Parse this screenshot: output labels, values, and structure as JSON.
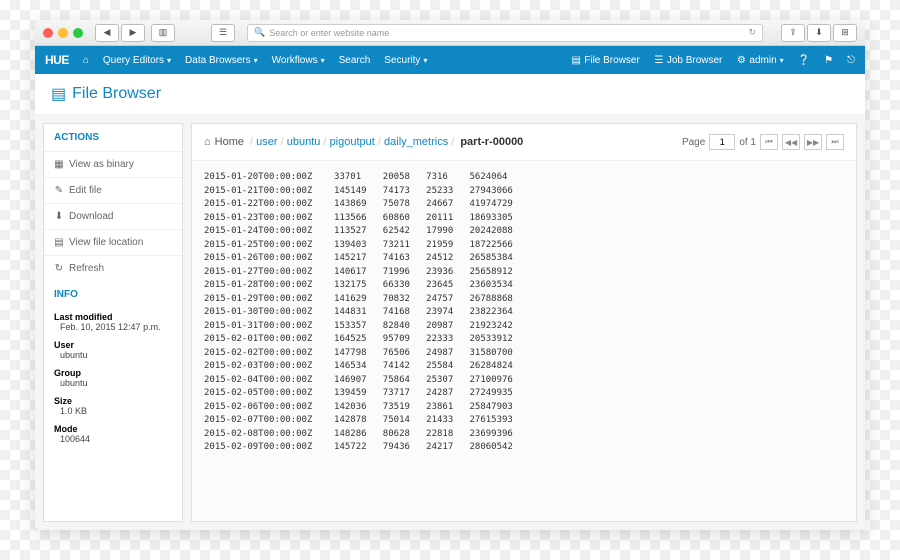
{
  "browser": {
    "placeholder": "Search or enter website name"
  },
  "topnav": {
    "logo": "HUE",
    "home": "⌂",
    "items": [
      "Query Editors",
      "Data Browsers",
      "Workflows",
      "Search",
      "Security"
    ],
    "right": {
      "file_browser": "File Browser",
      "job_browser": "Job Browser",
      "user": "admin"
    }
  },
  "page_title": "File Browser",
  "sidebar": {
    "actions_hdr": "ACTIONS",
    "actions": [
      {
        "icon": "▦",
        "label": "View as binary"
      },
      {
        "icon": "✎",
        "label": "Edit file"
      },
      {
        "icon": "⬇",
        "label": "Download"
      },
      {
        "icon": "▤",
        "label": "View file location"
      },
      {
        "icon": "↻",
        "label": "Refresh"
      }
    ],
    "info_hdr": "INFO",
    "info": {
      "last_modified_lbl": "Last modified",
      "last_modified": "Feb. 10, 2015 12:47 p.m.",
      "user_lbl": "User",
      "user": "ubuntu",
      "group_lbl": "Group",
      "group": "ubuntu",
      "size_lbl": "Size",
      "size": "1.0 KB",
      "mode_lbl": "Mode",
      "mode": "100644"
    }
  },
  "breadcrumb": {
    "home": "Home",
    "parts": [
      "user",
      "ubuntu",
      "pigoutput",
      "daily_metrics"
    ],
    "current": "part-r-00000"
  },
  "pager": {
    "page_lbl": "Page",
    "page": "1",
    "of_lbl": "of 1"
  },
  "file_rows": [
    [
      "2015-01-20T00:00:00Z",
      "33701",
      "20058",
      "7316",
      "5624064"
    ],
    [
      "2015-01-21T00:00:00Z",
      "145149",
      "74173",
      "25233",
      "27943066"
    ],
    [
      "2015-01-22T00:00:00Z",
      "143869",
      "75078",
      "24667",
      "41974729"
    ],
    [
      "2015-01-23T00:00:00Z",
      "113566",
      "60860",
      "20111",
      "18693305"
    ],
    [
      "2015-01-24T00:00:00Z",
      "113527",
      "62542",
      "17990",
      "20242088"
    ],
    [
      "2015-01-25T00:00:00Z",
      "139403",
      "73211",
      "21959",
      "18722566"
    ],
    [
      "2015-01-26T00:00:00Z",
      "145217",
      "74163",
      "24512",
      "26585384"
    ],
    [
      "2015-01-27T00:00:00Z",
      "140617",
      "71996",
      "23936",
      "25658912"
    ],
    [
      "2015-01-28T00:00:00Z",
      "132175",
      "66330",
      "23645",
      "23603534"
    ],
    [
      "2015-01-29T00:00:00Z",
      "141629",
      "70832",
      "24757",
      "26788868"
    ],
    [
      "2015-01-30T00:00:00Z",
      "144831",
      "74168",
      "23974",
      "23822364"
    ],
    [
      "2015-01-31T00:00:00Z",
      "153357",
      "82840",
      "20987",
      "21923242"
    ],
    [
      "2015-02-01T00:00:00Z",
      "164525",
      "95709",
      "22333",
      "20533912"
    ],
    [
      "2015-02-02T00:00:00Z",
      "147798",
      "76506",
      "24987",
      "31580700"
    ],
    [
      "2015-02-03T00:00:00Z",
      "146534",
      "74142",
      "25584",
      "26284824"
    ],
    [
      "2015-02-04T00:00:00Z",
      "146907",
      "75864",
      "25307",
      "27100976"
    ],
    [
      "2015-02-05T00:00:00Z",
      "139459",
      "73717",
      "24287",
      "27249935"
    ],
    [
      "2015-02-06T00:00:00Z",
      "142036",
      "73519",
      "23861",
      "25847903"
    ],
    [
      "2015-02-07T00:00:00Z",
      "142878",
      "75014",
      "21433",
      "27615393"
    ],
    [
      "2015-02-08T00:00:00Z",
      "148286",
      "80628",
      "22818",
      "23699396"
    ],
    [
      "2015-02-09T00:00:00Z",
      "145722",
      "79436",
      "24217",
      "28060542"
    ]
  ]
}
